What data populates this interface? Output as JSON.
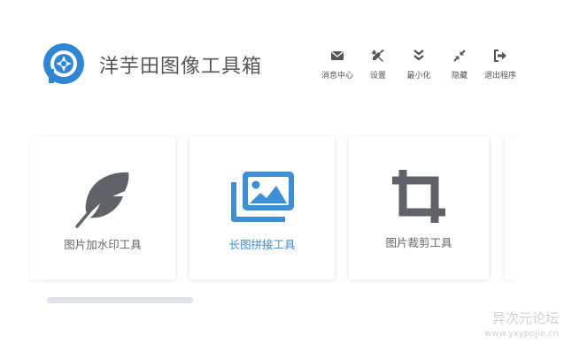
{
  "app": {
    "title": "洋芋田图像工具箱"
  },
  "toolbar": {
    "messages": "消息中心",
    "settings": "设置",
    "minimize": "最小化",
    "hide": "隐藏",
    "exit": "退出程序"
  },
  "tools": [
    {
      "label": "图片加水印工具",
      "icon": "feather-icon"
    },
    {
      "label": "长图拼接工具",
      "icon": "images-icon"
    },
    {
      "label": "图片裁剪工具",
      "icon": "crop-icon"
    }
  ],
  "watermark": {
    "line1": "异次元论坛",
    "line2": "www.yxypojie.cn"
  },
  "colors": {
    "accent": "#3b8fd6",
    "icon_gray": "#5f6368",
    "scroll": "#dfe2e6"
  }
}
